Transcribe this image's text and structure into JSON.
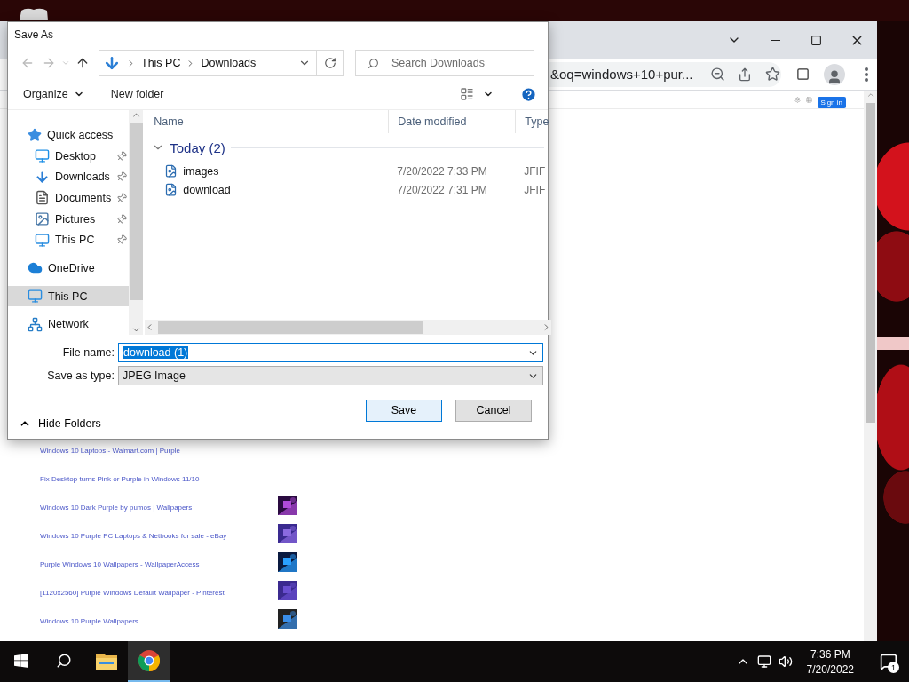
{
  "browser": {
    "address": "&oq=windows+10+pur...",
    "sign_in": "Sign in",
    "results": [
      {
        "title": "Windows 10 Laptops - Walmart.com | Purple",
        "thumbnail": false
      },
      {
        "title": "Fix Desktop turns Pink or Purple in Windows 11/10",
        "thumbnail": false
      },
      {
        "title": "Windows 10 Dark Purple by pumos | Wallpapers",
        "thumbnail": true
      },
      {
        "title": "Windows 10 Purple PC Laptops & Netbooks for sale - eBay",
        "thumbnail": true
      },
      {
        "title": "Purple Windows 10 Wallpapers - WallpaperAccess",
        "thumbnail": true
      },
      {
        "title": "[1120x2560] Purple Windows Default Wallpaper - Pinterest",
        "thumbnail": true
      },
      {
        "title": "Windows 10 Purple Wallpapers",
        "thumbnail": true
      }
    ]
  },
  "dialog": {
    "title": "Save As",
    "breadcrumb": [
      "This PC",
      "Downloads"
    ],
    "search": {
      "placeholder": "Search Downloads"
    },
    "toolbar": {
      "organize": "Organize",
      "new_folder": "New folder"
    },
    "navigation": [
      {
        "label": "Quick access",
        "selected": false,
        "pinned": false,
        "children": [
          {
            "label": "Desktop",
            "selected": false,
            "pinned": true
          },
          {
            "label": "Downloads",
            "selected": false,
            "pinned": true
          },
          {
            "label": "Documents",
            "selected": false,
            "pinned": true
          },
          {
            "label": "Pictures",
            "selected": false,
            "pinned": true
          },
          {
            "label": "This PC",
            "selected": false,
            "pinned": true
          }
        ]
      },
      {
        "label": "OneDrive",
        "selected": false,
        "pinned": false
      },
      {
        "label": "This PC",
        "selected": true,
        "pinned": false
      },
      {
        "label": "Network",
        "selected": false,
        "pinned": false
      }
    ],
    "columns": [
      "Name",
      "Date modified",
      "Type"
    ],
    "group": {
      "label": "Today (2)",
      "expanded": true
    },
    "files": [
      {
        "name": "images",
        "date": "7/20/2022 7:33 PM",
        "type": "JFIF"
      },
      {
        "name": "download",
        "date": "7/20/2022 7:31 PM",
        "type": "JFIF"
      }
    ],
    "file_name": {
      "label": "File name:",
      "value": "download (1)",
      "text_selected": true
    },
    "save_as_type": {
      "label": "Save as type:",
      "value": "JPEG Image"
    },
    "hide_folders": "Hide Folders",
    "buttons": [
      "Save",
      "Cancel"
    ]
  },
  "taskbar": {
    "apps": [
      {
        "selected": false
      },
      {
        "selected": true
      }
    ],
    "time": "7:36 PM",
    "date": "7/20/2022",
    "notifications": "1"
  }
}
